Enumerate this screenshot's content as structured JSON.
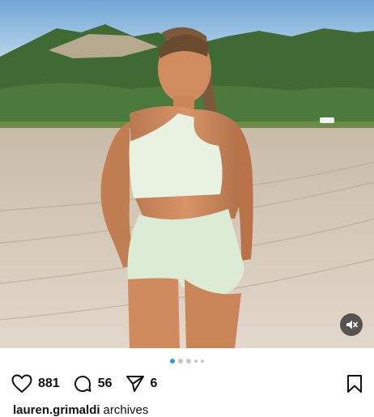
{
  "post": {
    "image_alt": "Woman in mint green two-piece on a sandy beach at sunset",
    "mute_icon": "speaker-muted-icon"
  },
  "carousel": {
    "dots": [
      {
        "state": "active"
      },
      {
        "state": "inactive"
      },
      {
        "state": "inactive"
      },
      {
        "state": "inactive-small"
      },
      {
        "state": "inactive-small"
      }
    ],
    "active_color": "#2d9cdb"
  },
  "actions": {
    "like": {
      "icon": "heart-icon",
      "count": "881"
    },
    "comment": {
      "icon": "comment-icon",
      "count": "56"
    },
    "share": {
      "icon": "send-icon",
      "count": "6"
    },
    "save": {
      "icon": "bookmark-icon"
    }
  },
  "caption": {
    "username": "lauren.grimaldi",
    "text": "archives"
  }
}
